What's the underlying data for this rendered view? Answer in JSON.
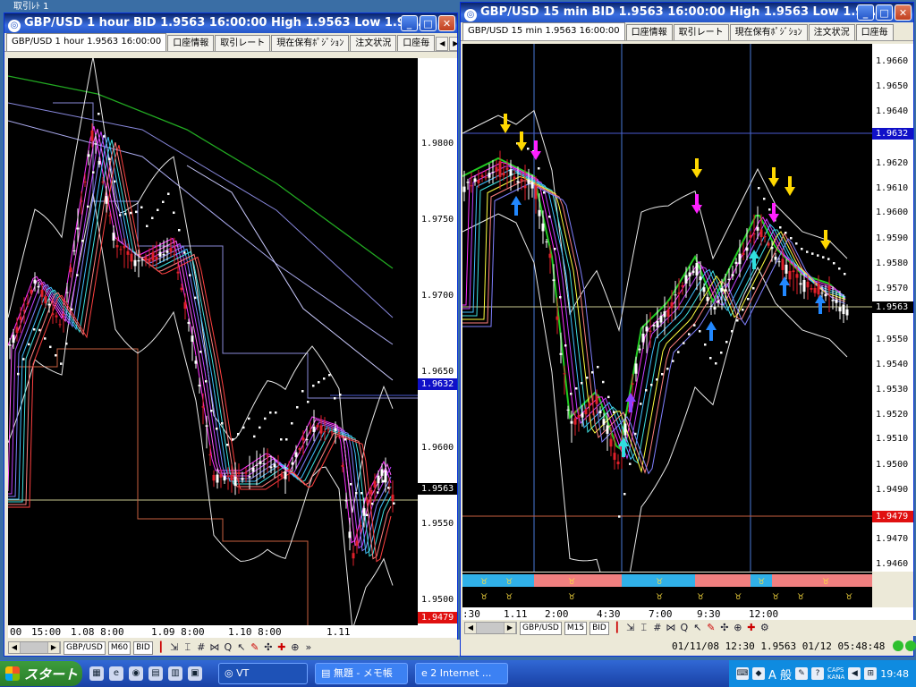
{
  "left_window": {
    "bg_title": "取引ﾚﾄ 1",
    "title": "GBP/USD 1 hour BID 1.9563 16:00:00 High 1.9563 Low 1.95...",
    "tabs": [
      "GBP/USD 1 hour 1.9563 16:00:00",
      "口座情報",
      "取引レート",
      "現在保有ﾎﾟｼﾞｼｮﾝ",
      "注文状況",
      "口座毎"
    ],
    "price_labels": [
      "1.9800",
      "1.9750",
      "1.9700",
      "1.9650",
      "1.9600",
      "1.9550",
      "1.9500"
    ],
    "badge_blue": "1.9632",
    "badge_black": "1.9563",
    "badge_red": "1.9479",
    "time_labels": [
      "00",
      "15:00",
      "1.08 8:00",
      "1.09 8:00",
      "1.10 8:00",
      "1.11"
    ],
    "toolbar": {
      "symbol": "GBP/USD",
      "timeframe": "M60",
      "side": "BID"
    }
  },
  "right_window": {
    "title": "GBP/USD 15 min BID 1.9563 16:00:00 High 1.9563 Low 1.95...",
    "tabs": [
      "GBP/USD 15 min 1.9563 16:00:00",
      "口座情報",
      "取引レート",
      "現在保有ﾎﾟｼﾞｼｮﾝ",
      "注文状況",
      "口座毎"
    ],
    "price_labels": [
      "1.9660",
      "1.9650",
      "1.9640",
      "1.9620",
      "1.9610",
      "1.9600",
      "1.9590",
      "1.9580",
      "1.9570",
      "1.9550",
      "1.9540",
      "1.9530",
      "1.9520",
      "1.9510",
      "1.9500",
      "1.9490",
      "1.9470",
      "1.9460"
    ],
    "badge_blue": "1.9632",
    "badge_black": "1.9563",
    "badge_red": "1.9479",
    "time_labels": [
      ":30",
      "1.11",
      "2:00",
      "4:30",
      "7:00",
      "9:30",
      "12:00"
    ],
    "toolbar": {
      "symbol": "GBP/USD",
      "timeframe": "M15",
      "side": "BID"
    },
    "status": {
      "t1": "01/11/08 12:30",
      "price": "1.9563",
      "t2": "01/12 05:48:48"
    }
  },
  "taskbar": {
    "start": "スタート",
    "tasks": [
      "VT",
      "無題 - メモ帳",
      "2 Internet ..."
    ],
    "ime": "A 般",
    "caps": "CAPS",
    "kana": "KANA",
    "clock": "19:48"
  },
  "colors": {
    "title_blue": "#2456c8",
    "chart_bg": "#000000",
    "bull": "#ffffff",
    "bear": "#e0202a",
    "ma_green": "#22aa22",
    "badge_blue": "#1010c8",
    "badge_red": "#e01010"
  }
}
